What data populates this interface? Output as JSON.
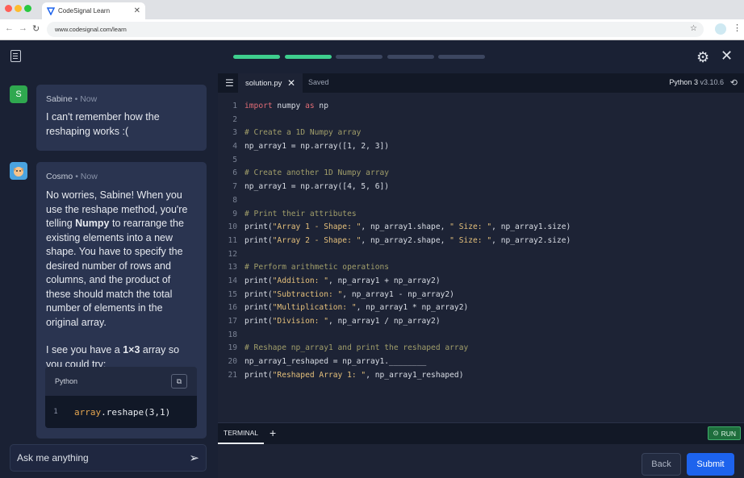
{
  "browser": {
    "tab_title": "CodeSignal Learn",
    "url": "www.codesignal.com/learn"
  },
  "progress": [
    {
      "state": "done",
      "color": "#3ecf8e"
    },
    {
      "state": "done",
      "color": "#3ecf8e"
    },
    {
      "state": "todo",
      "color": "#3c4660"
    },
    {
      "state": "todo",
      "color": "#3c4660"
    },
    {
      "state": "todo",
      "color": "#3c4660"
    }
  ],
  "chat": {
    "user_message": {
      "avatar_letter": "S",
      "name": "Sabine",
      "time": "Now",
      "text": "I can't remember how the reshaping works :("
    },
    "bot_message": {
      "name": "Cosmo",
      "time": "Now",
      "para1_a": "No worries, Sabine! When you use the reshape method, you're telling ",
      "para1_bold": "Numpy",
      "para1_b": " to rearrange the existing elements into a new shape. You have to specify the desired number of rows and columns, and the product of these should match the total number of elements in the original array.",
      "para2_a": "I see you have a ",
      "para2_bold": "1×3",
      "para2_b": " array so you could try:",
      "code_lang": "Python",
      "code_line_no": "1",
      "code_obj": "array",
      "code_rest": ".reshape(3,1)"
    },
    "input_placeholder": "Ask me anything"
  },
  "editor": {
    "file_name": "solution.py",
    "saved_label": "Saved",
    "python_label": "Python 3",
    "python_version": "v3.10.6",
    "terminal_label": "TERMINAL",
    "run_label": "RUN",
    "back_label": "Back",
    "submit_label": "Submit"
  },
  "code_lines": [
    {
      "n": "1",
      "segs": [
        [
          "kw",
          "import"
        ],
        [
          "fn",
          " numpy "
        ],
        [
          "kw",
          "as"
        ],
        [
          "fn",
          " np"
        ]
      ]
    },
    {
      "n": "2",
      "segs": []
    },
    {
      "n": "3",
      "segs": [
        [
          "cm",
          "# Create a 1D Numpy array"
        ]
      ]
    },
    {
      "n": "4",
      "segs": [
        [
          "fn",
          "np_array1 = np.array([1, 2, 3])"
        ]
      ]
    },
    {
      "n": "5",
      "segs": []
    },
    {
      "n": "6",
      "segs": [
        [
          "cm",
          "# Create another 1D Numpy array"
        ]
      ]
    },
    {
      "n": "7",
      "segs": [
        [
          "fn",
          "np_array1 = np.array([4, 5, 6])"
        ]
      ]
    },
    {
      "n": "8",
      "segs": []
    },
    {
      "n": "9",
      "segs": [
        [
          "cm",
          "# Print their attributes"
        ]
      ]
    },
    {
      "n": "10",
      "segs": [
        [
          "fn",
          "print("
        ],
        [
          "st",
          "\"Array 1 - Shape: \""
        ],
        [
          "fn",
          ", np_array1.shape, "
        ],
        [
          "st",
          "\" Size: \""
        ],
        [
          "fn",
          ", np_array1.size)"
        ]
      ]
    },
    {
      "n": "11",
      "segs": [
        [
          "fn",
          "print("
        ],
        [
          "st",
          "\"Array 2 - Shape: \""
        ],
        [
          "fn",
          ", np_array2.shape, "
        ],
        [
          "st",
          "\" Size: \""
        ],
        [
          "fn",
          ", np_array2.size)"
        ]
      ]
    },
    {
      "n": "12",
      "segs": []
    },
    {
      "n": "13",
      "segs": [
        [
          "cm",
          "# Perform arithmetic operations"
        ]
      ]
    },
    {
      "n": "14",
      "segs": [
        [
          "fn",
          "print("
        ],
        [
          "st",
          "\"Addition: \""
        ],
        [
          "fn",
          ", np_array1 + np_array2)"
        ]
      ]
    },
    {
      "n": "15",
      "segs": [
        [
          "fn",
          "print("
        ],
        [
          "st",
          "\"Subtraction: \""
        ],
        [
          "fn",
          ", np_array1 - np_array2)"
        ]
      ]
    },
    {
      "n": "16",
      "segs": [
        [
          "fn",
          "print("
        ],
        [
          "st",
          "\"Multiplication: \""
        ],
        [
          "fn",
          ", np_array1 * np_array2)"
        ]
      ]
    },
    {
      "n": "17",
      "segs": [
        [
          "fn",
          "print("
        ],
        [
          "st",
          "\"Division: \""
        ],
        [
          "fn",
          ", np_array1 / np_array2)"
        ]
      ]
    },
    {
      "n": "18",
      "segs": []
    },
    {
      "n": "19",
      "segs": [
        [
          "cm",
          "# Reshape np_array1 and print the reshaped array"
        ]
      ]
    },
    {
      "n": "20",
      "segs": [
        [
          "fn",
          "np_array1_reshaped = np_array1.________"
        ]
      ]
    },
    {
      "n": "21",
      "segs": [
        [
          "fn",
          "print("
        ],
        [
          "st",
          "\"Reshaped Array 1: \""
        ],
        [
          "fn",
          ", np_array1_reshaped)"
        ]
      ]
    }
  ]
}
